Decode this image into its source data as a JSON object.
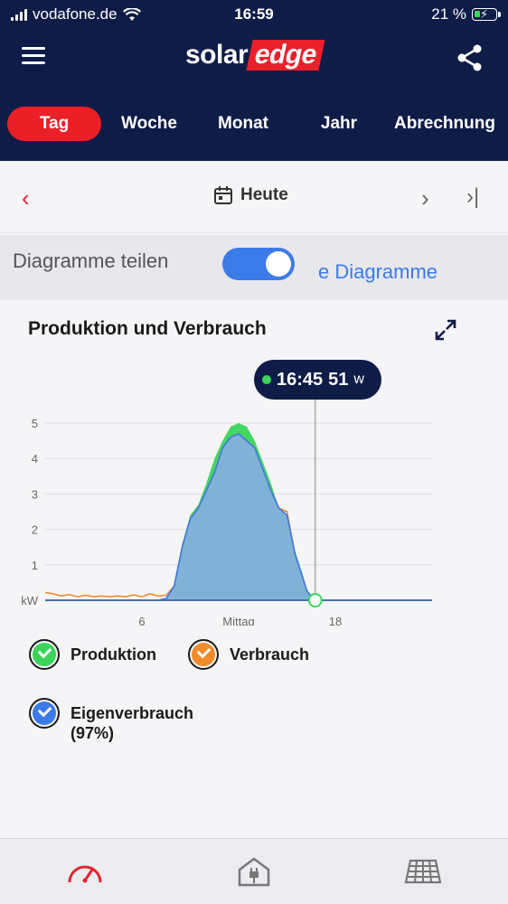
{
  "status_bar": {
    "carrier": "vodafone.de",
    "time": "16:59",
    "battery": "21 %"
  },
  "app": {
    "logo_part1": "solar",
    "logo_part2": "edge"
  },
  "tabs": [
    {
      "label": "Tag",
      "active": true
    },
    {
      "label": "Woche",
      "active": false
    },
    {
      "label": "Monat",
      "active": false
    },
    {
      "label": "Jahr",
      "active": false
    },
    {
      "label": "Abrechnung",
      "active": false
    }
  ],
  "date_nav": {
    "label": "Heute"
  },
  "share_bar": {
    "label": "Diagramme teilen",
    "link": "e Diagramme",
    "toggle_on": true
  },
  "card": {
    "title": "Produktion und Verbrauch",
    "tooltip_time": "16:45",
    "tooltip_value": "51",
    "tooltip_unit": "w"
  },
  "chart_data": {
    "type": "area",
    "title": "Produktion und Verbrauch",
    "ylabel": "kW",
    "ylim": [
      0,
      5
    ],
    "yticks": [
      "1",
      "2",
      "3",
      "4",
      "5"
    ],
    "xticks": [
      {
        "hour": 6,
        "label": "6"
      },
      {
        "hour": 12,
        "label": "Mittag"
      },
      {
        "hour": 18,
        "label": "18"
      }
    ],
    "xlim": [
      0,
      24
    ],
    "grid": true,
    "cursor_hour": 16.75,
    "x": [
      0,
      0.5,
      1,
      1.5,
      2,
      2.5,
      3,
      3.5,
      4,
      4.5,
      5,
      5.5,
      6,
      6.5,
      7,
      7.5,
      8,
      8.5,
      9,
      9.5,
      10,
      10.5,
      11,
      11.5,
      12,
      12.5,
      13,
      13.5,
      14,
      14.5,
      15,
      15.5,
      16,
      16.25,
      16.5,
      16.75,
      17,
      18,
      20,
      22,
      24
    ],
    "series": [
      {
        "name": "Produktion",
        "color": "#3ad45a",
        "values": [
          0,
          0,
          0,
          0,
          0,
          0,
          0,
          0,
          0,
          0,
          0,
          0,
          0,
          0,
          0,
          0.05,
          0.4,
          1.6,
          2.4,
          2.7,
          3.3,
          4.0,
          4.5,
          4.9,
          5.0,
          4.9,
          4.5,
          3.9,
          3.3,
          2.6,
          2.4,
          1.4,
          0.7,
          0.3,
          0.15,
          0.05,
          0,
          0,
          0,
          0,
          0
        ]
      },
      {
        "name": "Verbrauch",
        "color": "#f08c2a",
        "values": [
          0.22,
          0.18,
          0.12,
          0.16,
          0.1,
          0.14,
          0.1,
          0.12,
          0.1,
          0.12,
          0.1,
          0.15,
          0.1,
          0.18,
          0.12,
          0.14,
          0.4,
          1.5,
          2.3,
          2.6,
          3.1,
          3.6,
          4.3,
          4.6,
          4.7,
          4.5,
          4.3,
          3.7,
          3.1,
          2.6,
          2.5,
          1.3,
          0.6,
          0.25,
          0.1,
          0.05,
          0,
          0,
          0,
          0,
          0
        ]
      },
      {
        "name": "Eigenverbrauch",
        "color": "#3b7be8",
        "share": "(97%)",
        "values": [
          0,
          0,
          0,
          0,
          0,
          0,
          0,
          0,
          0,
          0,
          0,
          0,
          0,
          0,
          0,
          0.05,
          0.4,
          1.5,
          2.3,
          2.6,
          3.1,
          3.6,
          4.3,
          4.6,
          4.7,
          4.5,
          4.3,
          3.7,
          3.1,
          2.6,
          2.4,
          1.3,
          0.6,
          0.25,
          0.1,
          0.05,
          0,
          0,
          0,
          0,
          0
        ]
      }
    ]
  },
  "legend": [
    {
      "label": "Produktion",
      "color": "#3ad45a"
    },
    {
      "label": "Verbrauch",
      "color": "#f08c2a"
    },
    {
      "label": "Eigenverbrauch",
      "sub": "(97%)",
      "color": "#3b7be8"
    }
  ],
  "bottom_nav": [
    {
      "icon": "gauge-icon",
      "active": true
    },
    {
      "icon": "house-plug-icon",
      "active": false
    },
    {
      "icon": "solar-panel-icon",
      "active": false
    }
  ],
  "colors": {
    "brand_dark": "#0f1c47",
    "brand_red": "#ea2027",
    "link_blue": "#3b7be8"
  }
}
